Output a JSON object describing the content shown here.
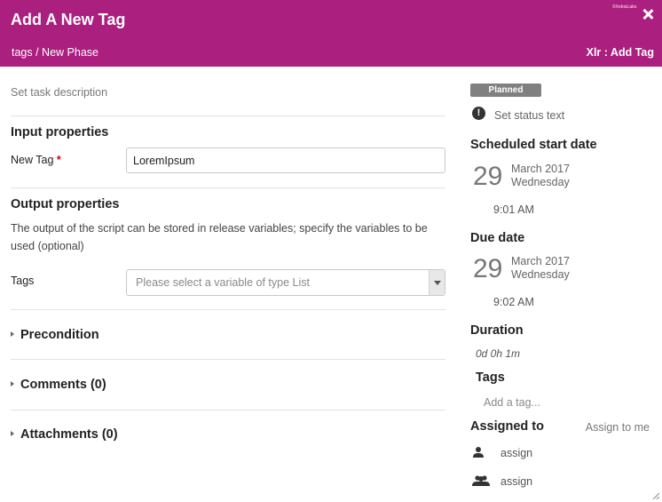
{
  "header": {
    "title": "Add A New Tag",
    "breadcrumb": "tags / New Phase",
    "subtitle": "Xlr : Add Tag",
    "mini_logo": "©XebiaLabs",
    "close_icon": "close-icon",
    "background_color": "#ab1f7f"
  },
  "main": {
    "description_placeholder": "Set task description",
    "input_section": {
      "title": "Input properties",
      "new_tag_label": "New Tag",
      "required_marker": "*",
      "new_tag_value": "LoremIpsum"
    },
    "output_section": {
      "title": "Output properties",
      "description": "The output of the script can be stored in release variables; specify the variables to be used (optional)",
      "tags_label": "Tags",
      "tags_placeholder": "Please select a variable of type List"
    },
    "collapsibles": [
      {
        "label": "Precondition"
      },
      {
        "label": "Comments (0)"
      },
      {
        "label": "Attachments (0)"
      }
    ]
  },
  "sidebar": {
    "status_badge": "Planned",
    "status_placeholder": "Set status text",
    "scheduled_start": {
      "title": "Scheduled start date",
      "day": "29",
      "month_year": "March 2017",
      "weekday": "Wednesday",
      "time": "9:01 AM"
    },
    "due": {
      "title": "Due date",
      "day": "29",
      "month_year": "March 2017",
      "weekday": "Wednesday",
      "time": "9:02 AM"
    },
    "duration": {
      "title": "Duration",
      "value": "0d 0h 1m"
    },
    "tags": {
      "title": "Tags",
      "placeholder": "Add a tag..."
    },
    "assigned": {
      "title": "Assigned to",
      "assign_to_me": "Assign to me",
      "user_label": "assign",
      "team_label": "assign",
      "user_icon": "user-icon",
      "team_icon": "team-icon"
    }
  }
}
